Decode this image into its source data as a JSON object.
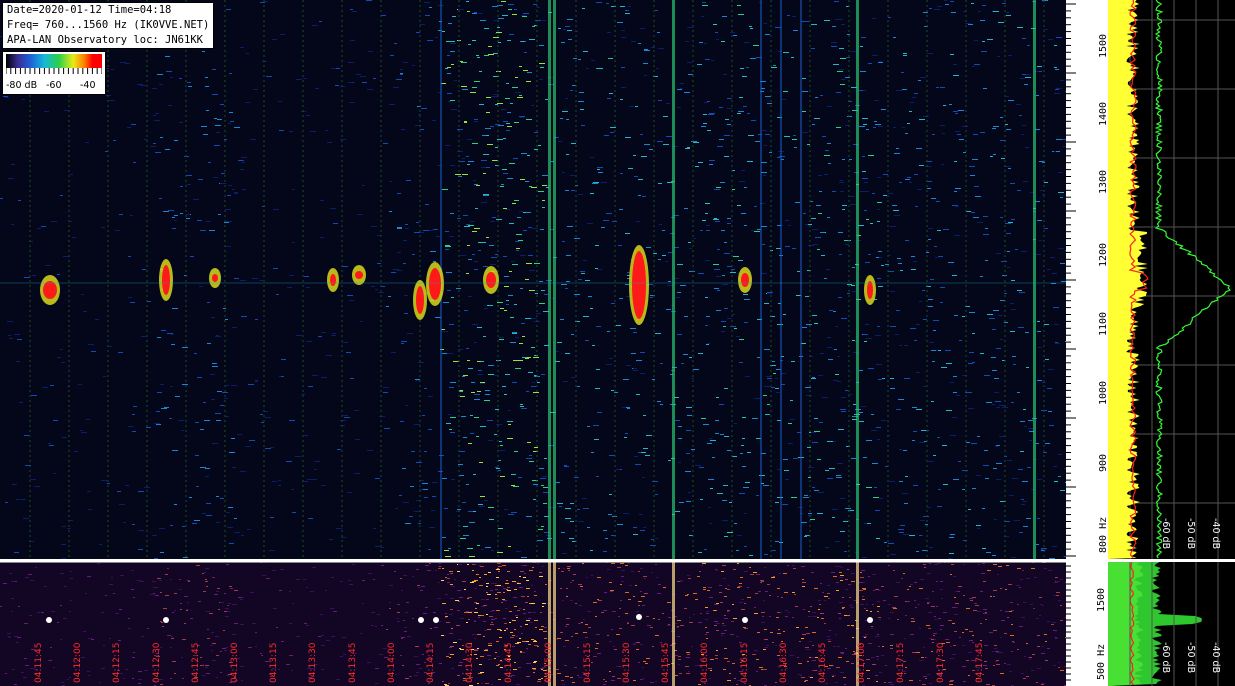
{
  "header": {
    "line1": "Date=2020-01-12 Time=04:18",
    "line2": "Freq= 760...1560 Hz (IK0VVE.NET)",
    "line3": "APA-LAN Observatory loc: JN61KK"
  },
  "colorbar": {
    "labels": [
      "-80 dB",
      "-60",
      "-40"
    ]
  },
  "freq_axis": {
    "ticks": [
      "1500",
      "1400",
      "1300",
      "1200",
      "1100",
      "1000",
      "900",
      "800 Hz"
    ],
    "unit": "Hz"
  },
  "freq_axis_bottom": {
    "ticks": [
      "1500",
      "500 Hz"
    ]
  },
  "spectrum_axis": {
    "labels": [
      "-60 dB",
      "-50 dB",
      "-40 dB"
    ]
  },
  "spectrum_axis_bottom": {
    "labels": [
      "-60 dB",
      "-50 dB",
      "-40 dB"
    ]
  },
  "timeline": {
    "labels": [
      "04:11:45",
      "04:12:00",
      "04:12:15",
      "04:12:30",
      "04:12:45",
      "04:13:00",
      "04:13:15",
      "04:13:30",
      "04:13:45",
      "04:14:00",
      "04:14:15",
      "04:14:30",
      "04:14:45",
      "04:15:00",
      "04:15:15",
      "04:15:30",
      "04:15:45",
      "04:16:00",
      "04:16:15",
      "04:16:30",
      "04:16:45",
      "04:17:00",
      "04:17:15",
      "04:17:30",
      "04:17:45"
    ]
  },
  "colors": {
    "spectrum_fill": "#ffff33",
    "spectrum_peak": "#33ff33",
    "spectrum_avg": "#ff2020",
    "time_label": "#ff2a2a"
  }
}
